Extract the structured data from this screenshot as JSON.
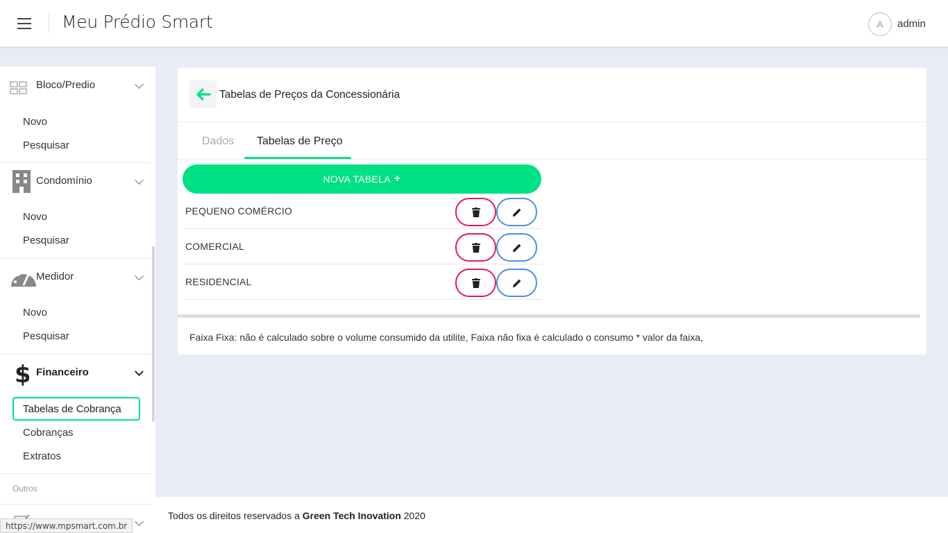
{
  "header": {
    "app_title": "Meu Prédio Smart",
    "user_initial": "A",
    "user_name": "admin"
  },
  "sidebar": {
    "sections": [
      {
        "label": "Bloco/Predio",
        "icon": "blocks-icon",
        "items": [
          "Novo",
          "Pesquisar"
        ]
      },
      {
        "label": "Condomínio",
        "icon": "building-icon",
        "items": [
          "Novo",
          "Pesquisar"
        ]
      },
      {
        "label": "Medidor",
        "icon": "gauge-icon",
        "items": [
          "Novo",
          "Pesquisar"
        ]
      },
      {
        "label": "Financeiro",
        "icon": "dollar-icon",
        "items": [
          "Tabelas de Cobrança",
          "Cobranças",
          "Extratos"
        ],
        "active_item": "Tabelas de Cobrança"
      }
    ],
    "category_other": "Outros"
  },
  "card": {
    "title": "Tabelas de Preços da Concessionária",
    "tabs": [
      {
        "label": "Dados",
        "active": false
      },
      {
        "label": "Tabelas de Preço",
        "active": true
      }
    ],
    "new_button_label": "NOVA TABELA",
    "rows": [
      {
        "label": "PEQUENO COMÉRCIO"
      },
      {
        "label": "COMERCIAL"
      },
      {
        "label": "RESIDENCIAL"
      }
    ],
    "note": "Faixa Fixa: não é calculado sobre o volume consumido da utilite, Faixa não fixa é calculado o consumo * valor da faixa,"
  },
  "footer": {
    "prefix": "Todos os direitos reservados a ",
    "company": "Green Tech Inovation",
    "year": " 2020"
  },
  "status_bar": {
    "url": "https://www.mpsmart.com.br"
  },
  "colors": {
    "accent": "#00e184",
    "danger": "#e6195f",
    "edit": "#4a90e2",
    "background": "#e9ecf5"
  }
}
